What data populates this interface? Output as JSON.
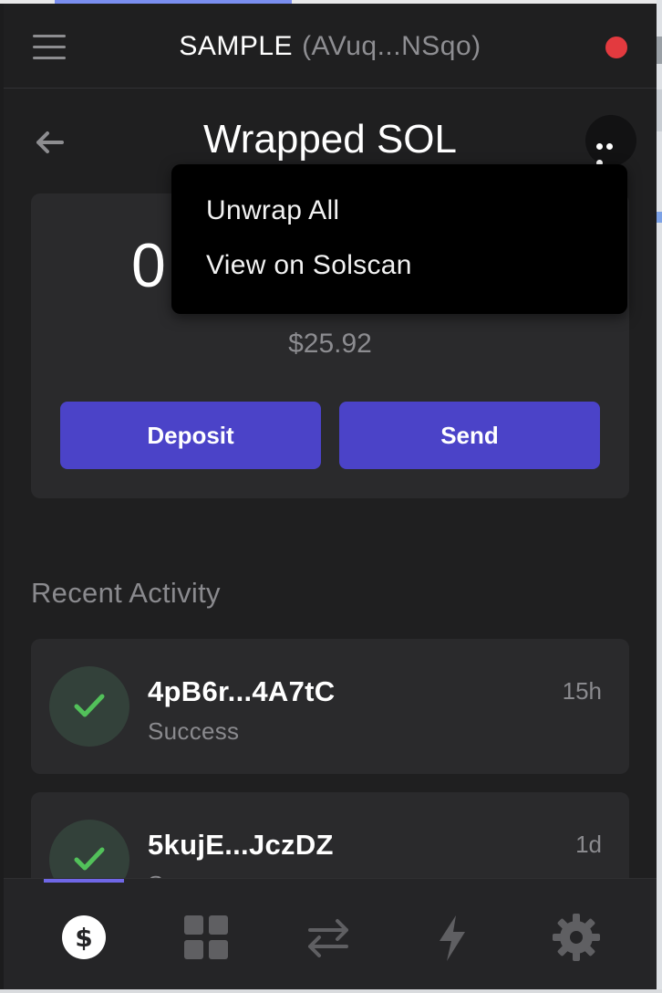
{
  "header": {
    "wallet_name": "SAMPLE",
    "wallet_address": "(AVuq...NSqo)",
    "status_color": "#e33a3f"
  },
  "token": {
    "title": "Wrapped SOL",
    "balance_partial": "0",
    "usd_value": "$25.92"
  },
  "menu": {
    "items": [
      "Unwrap All",
      "View on Solscan"
    ]
  },
  "actions": {
    "deposit_label": "Deposit",
    "send_label": "Send"
  },
  "activity": {
    "section_title": "Recent Activity",
    "items": [
      {
        "tx": "4pB6r...4A7tC",
        "status": "Success",
        "time": "15h"
      },
      {
        "tx": "5kujE...JczDZ",
        "status": "Success",
        "time": "1d"
      }
    ]
  },
  "tabs": [
    {
      "icon": "dollar-icon",
      "active": true
    },
    {
      "icon": "grid-icon",
      "active": false
    },
    {
      "icon": "swap-icon",
      "active": false
    },
    {
      "icon": "lightning-icon",
      "active": false
    },
    {
      "icon": "gear-icon",
      "active": false
    }
  ],
  "colors": {
    "accent": "#4b43c8",
    "tab_indicator": "#6f67e6",
    "success": "#52c15a",
    "background": "#1f1f20"
  }
}
